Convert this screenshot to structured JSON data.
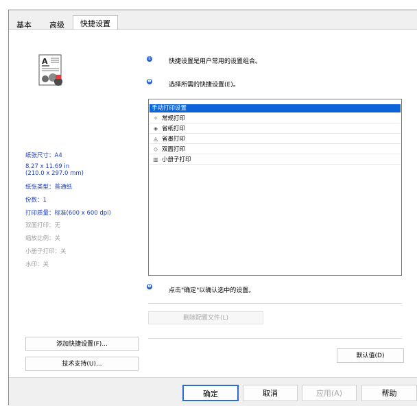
{
  "tabs": [
    "基本",
    "高级",
    "快捷设置"
  ],
  "settings_info": {
    "paper_size": "纸张尺寸：A4",
    "dimensions_in": "8.27 x 11.69 in",
    "dimensions_mm": "(210.0 x 297.0 mm)",
    "media_type": "纸张类型：普通纸",
    "copies": "份数：1",
    "print_quality": "打印质量：标准(600 x 600 dpi)",
    "duplex": "双面打印：无",
    "scaling": "缩放比例：关",
    "booklet": "小册子打印：关",
    "watermark": "水印：关"
  },
  "steps": {
    "step1": "快捷设置是用户常用的设置组合。",
    "step2": "选择所需的快捷设置(E)。",
    "step3": "点击\"确定\"以确认选中的设置。"
  },
  "profiles": [
    {
      "label": "手动打印设置",
      "icon": ""
    },
    {
      "label": "常规打印",
      "icon": "document-icon"
    },
    {
      "label": "省纸打印",
      "icon": "eco-paper-icon"
    },
    {
      "label": "省墨打印",
      "icon": "eco-ink-icon"
    },
    {
      "label": "双面打印",
      "icon": "duplex-icon"
    },
    {
      "label": "小册子打印",
      "icon": "booklet-icon"
    }
  ],
  "buttons": {
    "delete_profile": "删除配置文件(L)",
    "add_profile": "添加快捷设置(F)...",
    "support": "技术支持(U)...",
    "default": "默认值(D)",
    "ok": "确定",
    "cancel": "取消",
    "apply": "应用(A)",
    "help": "帮助"
  },
  "colors": {
    "accent": "#0c64d8",
    "info_text": "#1f3fbf",
    "disabled_text": "#a0a0a0"
  }
}
